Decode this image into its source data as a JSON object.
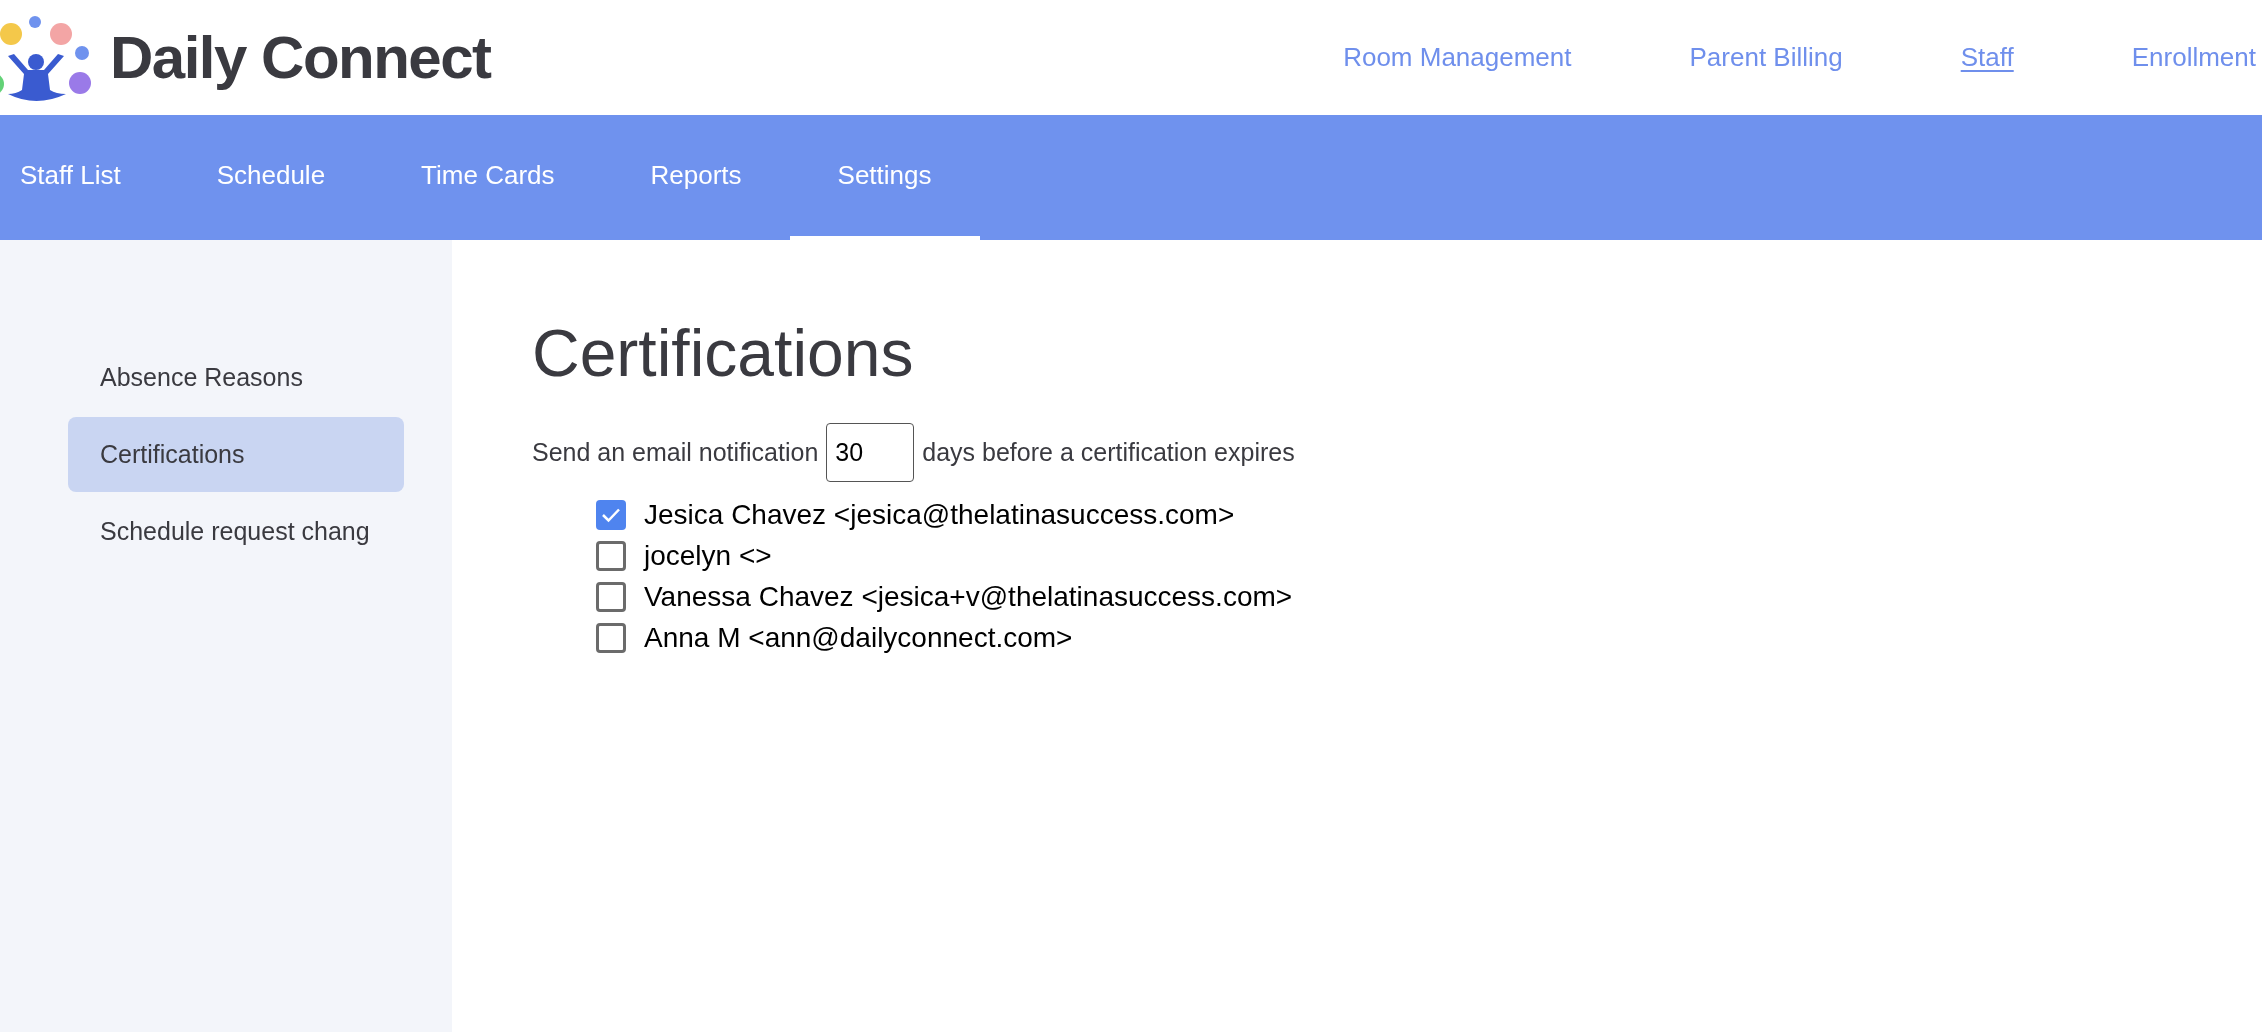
{
  "logo": {
    "text": "Daily Connect"
  },
  "top_nav": [
    {
      "label": "Room Management",
      "selected": false
    },
    {
      "label": "Parent Billing",
      "selected": false
    },
    {
      "label": "Staff",
      "selected": true
    },
    {
      "label": "Enrollment",
      "selected": false
    }
  ],
  "tabs": [
    {
      "label": "Staff List",
      "selected": false
    },
    {
      "label": "Schedule",
      "selected": false
    },
    {
      "label": "Time Cards",
      "selected": false
    },
    {
      "label": "Reports",
      "selected": false
    },
    {
      "label": "Settings",
      "selected": true
    }
  ],
  "sidebar": {
    "items": [
      {
        "label": "Absence Reasons",
        "selected": false
      },
      {
        "label": "Certifications",
        "selected": true
      },
      {
        "label": "Schedule request chang",
        "selected": false
      }
    ]
  },
  "content": {
    "title": "Certifications",
    "notification": {
      "before": "Send an email notification",
      "days": "30",
      "after": "days before a certification expires"
    },
    "recipients": [
      {
        "label": "Jesica Chavez <jesica@thelatinasuccess.com>",
        "checked": true
      },
      {
        "label": "jocelyn <>",
        "checked": false
      },
      {
        "label": "Vanessa Chavez <jesica+v@thelatinasuccess.com>",
        "checked": false
      },
      {
        "label": "Anna M <ann@dailyconnect.com>",
        "checked": false
      }
    ]
  }
}
